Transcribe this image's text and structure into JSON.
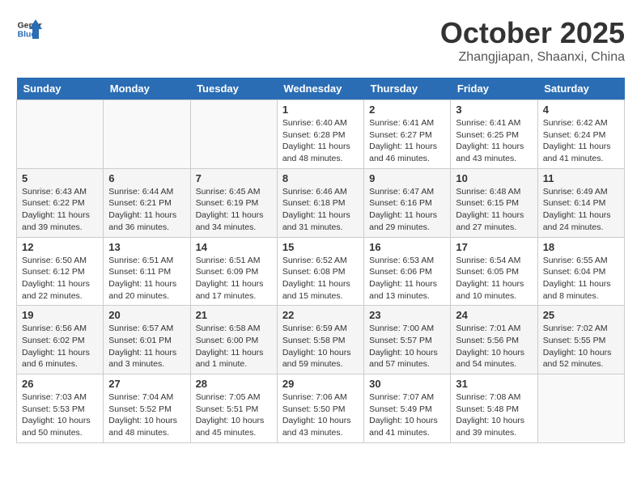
{
  "header": {
    "logo_line1": "General",
    "logo_line2": "Blue",
    "month_title": "October 2025",
    "location": "Zhangjiapan, Shaanxi, China"
  },
  "days_of_week": [
    "Sunday",
    "Monday",
    "Tuesday",
    "Wednesday",
    "Thursday",
    "Friday",
    "Saturday"
  ],
  "weeks": [
    [
      {
        "day": "",
        "info": ""
      },
      {
        "day": "",
        "info": ""
      },
      {
        "day": "",
        "info": ""
      },
      {
        "day": "1",
        "info": "Sunrise: 6:40 AM\nSunset: 6:28 PM\nDaylight: 11 hours and 48 minutes."
      },
      {
        "day": "2",
        "info": "Sunrise: 6:41 AM\nSunset: 6:27 PM\nDaylight: 11 hours and 46 minutes."
      },
      {
        "day": "3",
        "info": "Sunrise: 6:41 AM\nSunset: 6:25 PM\nDaylight: 11 hours and 43 minutes."
      },
      {
        "day": "4",
        "info": "Sunrise: 6:42 AM\nSunset: 6:24 PM\nDaylight: 11 hours and 41 minutes."
      }
    ],
    [
      {
        "day": "5",
        "info": "Sunrise: 6:43 AM\nSunset: 6:22 PM\nDaylight: 11 hours and 39 minutes."
      },
      {
        "day": "6",
        "info": "Sunrise: 6:44 AM\nSunset: 6:21 PM\nDaylight: 11 hours and 36 minutes."
      },
      {
        "day": "7",
        "info": "Sunrise: 6:45 AM\nSunset: 6:19 PM\nDaylight: 11 hours and 34 minutes."
      },
      {
        "day": "8",
        "info": "Sunrise: 6:46 AM\nSunset: 6:18 PM\nDaylight: 11 hours and 31 minutes."
      },
      {
        "day": "9",
        "info": "Sunrise: 6:47 AM\nSunset: 6:16 PM\nDaylight: 11 hours and 29 minutes."
      },
      {
        "day": "10",
        "info": "Sunrise: 6:48 AM\nSunset: 6:15 PM\nDaylight: 11 hours and 27 minutes."
      },
      {
        "day": "11",
        "info": "Sunrise: 6:49 AM\nSunset: 6:14 PM\nDaylight: 11 hours and 24 minutes."
      }
    ],
    [
      {
        "day": "12",
        "info": "Sunrise: 6:50 AM\nSunset: 6:12 PM\nDaylight: 11 hours and 22 minutes."
      },
      {
        "day": "13",
        "info": "Sunrise: 6:51 AM\nSunset: 6:11 PM\nDaylight: 11 hours and 20 minutes."
      },
      {
        "day": "14",
        "info": "Sunrise: 6:51 AM\nSunset: 6:09 PM\nDaylight: 11 hours and 17 minutes."
      },
      {
        "day": "15",
        "info": "Sunrise: 6:52 AM\nSunset: 6:08 PM\nDaylight: 11 hours and 15 minutes."
      },
      {
        "day": "16",
        "info": "Sunrise: 6:53 AM\nSunset: 6:06 PM\nDaylight: 11 hours and 13 minutes."
      },
      {
        "day": "17",
        "info": "Sunrise: 6:54 AM\nSunset: 6:05 PM\nDaylight: 11 hours and 10 minutes."
      },
      {
        "day": "18",
        "info": "Sunrise: 6:55 AM\nSunset: 6:04 PM\nDaylight: 11 hours and 8 minutes."
      }
    ],
    [
      {
        "day": "19",
        "info": "Sunrise: 6:56 AM\nSunset: 6:02 PM\nDaylight: 11 hours and 6 minutes."
      },
      {
        "day": "20",
        "info": "Sunrise: 6:57 AM\nSunset: 6:01 PM\nDaylight: 11 hours and 3 minutes."
      },
      {
        "day": "21",
        "info": "Sunrise: 6:58 AM\nSunset: 6:00 PM\nDaylight: 11 hours and 1 minute."
      },
      {
        "day": "22",
        "info": "Sunrise: 6:59 AM\nSunset: 5:58 PM\nDaylight: 10 hours and 59 minutes."
      },
      {
        "day": "23",
        "info": "Sunrise: 7:00 AM\nSunset: 5:57 PM\nDaylight: 10 hours and 57 minutes."
      },
      {
        "day": "24",
        "info": "Sunrise: 7:01 AM\nSunset: 5:56 PM\nDaylight: 10 hours and 54 minutes."
      },
      {
        "day": "25",
        "info": "Sunrise: 7:02 AM\nSunset: 5:55 PM\nDaylight: 10 hours and 52 minutes."
      }
    ],
    [
      {
        "day": "26",
        "info": "Sunrise: 7:03 AM\nSunset: 5:53 PM\nDaylight: 10 hours and 50 minutes."
      },
      {
        "day": "27",
        "info": "Sunrise: 7:04 AM\nSunset: 5:52 PM\nDaylight: 10 hours and 48 minutes."
      },
      {
        "day": "28",
        "info": "Sunrise: 7:05 AM\nSunset: 5:51 PM\nDaylight: 10 hours and 45 minutes."
      },
      {
        "day": "29",
        "info": "Sunrise: 7:06 AM\nSunset: 5:50 PM\nDaylight: 10 hours and 43 minutes."
      },
      {
        "day": "30",
        "info": "Sunrise: 7:07 AM\nSunset: 5:49 PM\nDaylight: 10 hours and 41 minutes."
      },
      {
        "day": "31",
        "info": "Sunrise: 7:08 AM\nSunset: 5:48 PM\nDaylight: 10 hours and 39 minutes."
      },
      {
        "day": "",
        "info": ""
      }
    ]
  ]
}
